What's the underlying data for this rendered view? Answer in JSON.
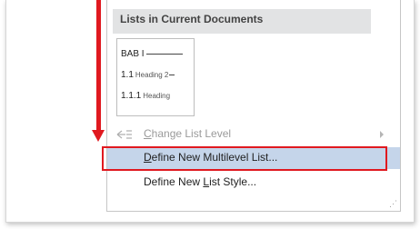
{
  "menu": {
    "section_title": "Lists in Current Documents",
    "thumbnail": {
      "level1_num": "BAB I",
      "level2_num": "1.1",
      "level2_text": "Heading 2",
      "level3_num": "1.1.1",
      "level3_text": "Heading"
    },
    "items": [
      {
        "pre": "",
        "acc": "C",
        "post": "hange List Level",
        "icon": "change-list-level-icon",
        "enabled": false,
        "has_submenu": true
      },
      {
        "pre": "",
        "acc": "D",
        "post": "efine New Multilevel List...",
        "enabled": true,
        "highlighted": true
      },
      {
        "pre": "Define New ",
        "acc": "L",
        "post": "ist Style...",
        "enabled": true
      }
    ]
  },
  "colors": {
    "annotation_red": "#e0191f",
    "hover_blue": "#c5d5ea",
    "header_gray": "#e2e3e4"
  }
}
